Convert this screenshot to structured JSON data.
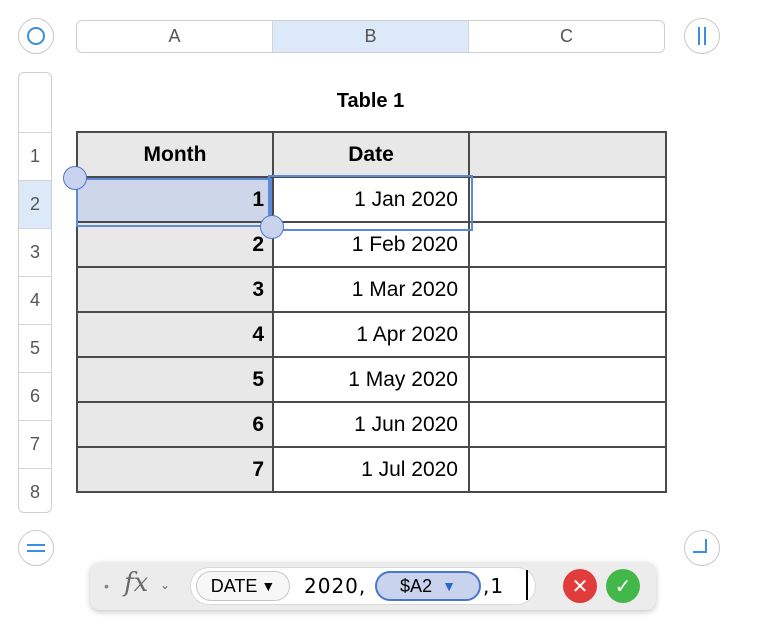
{
  "columns": [
    {
      "label": "A",
      "selected": false
    },
    {
      "label": "B",
      "selected": true
    },
    {
      "label": "C",
      "selected": false
    }
  ],
  "rows": [
    {
      "label": "1",
      "selected": false
    },
    {
      "label": "2",
      "selected": true
    },
    {
      "label": "3",
      "selected": false
    },
    {
      "label": "4",
      "selected": false
    },
    {
      "label": "5",
      "selected": false
    },
    {
      "label": "6",
      "selected": false
    },
    {
      "label": "7",
      "selected": false
    },
    {
      "label": "8",
      "selected": false
    }
  ],
  "table": {
    "title": "Table 1",
    "headers": [
      "Month",
      "Date",
      ""
    ],
    "data": [
      [
        "1",
        "1 Jan 2020",
        ""
      ],
      [
        "2",
        "1 Feb 2020",
        ""
      ],
      [
        "3",
        "1 Mar 2020",
        ""
      ],
      [
        "4",
        "1 Apr 2020",
        ""
      ],
      [
        "5",
        "1 May 2020",
        ""
      ],
      [
        "6",
        "1 Jun 2020",
        ""
      ],
      [
        "7",
        "1 Jul 2020",
        ""
      ]
    ]
  },
  "formula_bar": {
    "bullet": "•",
    "fx_label": "fx",
    "chevron": "⌄",
    "function_name": "DATE",
    "dropdown_arrow": "▼",
    "arg_year": "2020,",
    "reference": "$A2",
    "reference_arrow": "▼",
    "tail": ",1",
    "cancel_glyph": "✕",
    "accept_glyph": "✓"
  },
  "colors": {
    "accent": "#3b8fe0",
    "selection_fill": "#ced6ea",
    "selection_border": "#5b8ad6",
    "header_fill": "#e8e8e8",
    "cancel": "#e23b3b",
    "accept": "#43b84a"
  }
}
